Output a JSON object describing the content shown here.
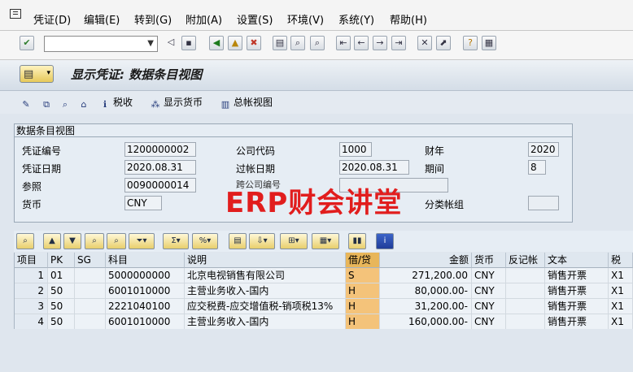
{
  "menu": {
    "items": [
      "凭证(D)",
      "编辑(E)",
      "转到(G)",
      "附加(A)",
      "设置(S)",
      "环境(V)",
      "系统(Y)",
      "帮助(H)"
    ]
  },
  "toolbar": {
    "command_field": "",
    "icons": [
      "enter-icon",
      "back-icon",
      "save-icon",
      "back-arrow-icon",
      "exit-icon",
      "cancel-icon",
      "print-icon",
      "find-icon",
      "find-next-icon",
      "first-page-icon",
      "prev-page-icon",
      "next-page-icon",
      "last-page-icon",
      "new-session-icon",
      "shortcut-icon",
      "help-icon",
      "layout-icon"
    ]
  },
  "title": {
    "text": "显示凭证: 数据条目视图"
  },
  "app_toolbar": {
    "tax_label": "税收",
    "display_currency_label": "显示货币",
    "general_ledger_label": "总帐视图"
  },
  "header_group": {
    "title": "数据条目视图",
    "doc_number_label": "凭证编号",
    "doc_number": "1200000002",
    "company_code_label": "公司代码",
    "company_code": "1000",
    "fiscal_year_label": "财年",
    "fiscal_year": "2020",
    "doc_date_label": "凭证日期",
    "doc_date": "2020.08.31",
    "posting_date_label": "过帐日期",
    "posting_date": "2020.08.31",
    "period_label": "期间",
    "period": "8",
    "reference_label": "参照",
    "reference": "0090000014",
    "cross_company_label": "跨公司编号",
    "currency_label": "货币",
    "currency": "CNY",
    "ledger_group_label": "分类帐组"
  },
  "watermark": "ERP财会讲堂",
  "items_table": {
    "columns": [
      "项目",
      "PK",
      "SG",
      "科目",
      "说明",
      "借/贷",
      "金额",
      "货币",
      "反记帐",
      "文本",
      "税"
    ],
    "rows": [
      [
        "1",
        "01",
        "",
        "5000000000",
        "北京电视销售有限公司",
        "S",
        "271,200.00",
        "CNY",
        "",
        "销售开票",
        "X1"
      ],
      [
        "2",
        "50",
        "",
        "6001010000",
        "主营业务收入-国内",
        "H",
        "80,000.00-",
        "CNY",
        "",
        "销售开票",
        "X1"
      ],
      [
        "3",
        "50",
        "",
        "2221040100",
        "应交税费-应交增值税-销项税13%",
        "H",
        "31,200.00-",
        "CNY",
        "",
        "销售开票",
        "X1"
      ],
      [
        "4",
        "50",
        "",
        "6001010000",
        "主营业务收入-国内",
        "H",
        "160,000.00-",
        "CNY",
        "",
        "销售开票",
        "X1"
      ]
    ]
  },
  "colors": {
    "highlight_column": "#f4c37a",
    "watermark": "#e11d1d"
  }
}
